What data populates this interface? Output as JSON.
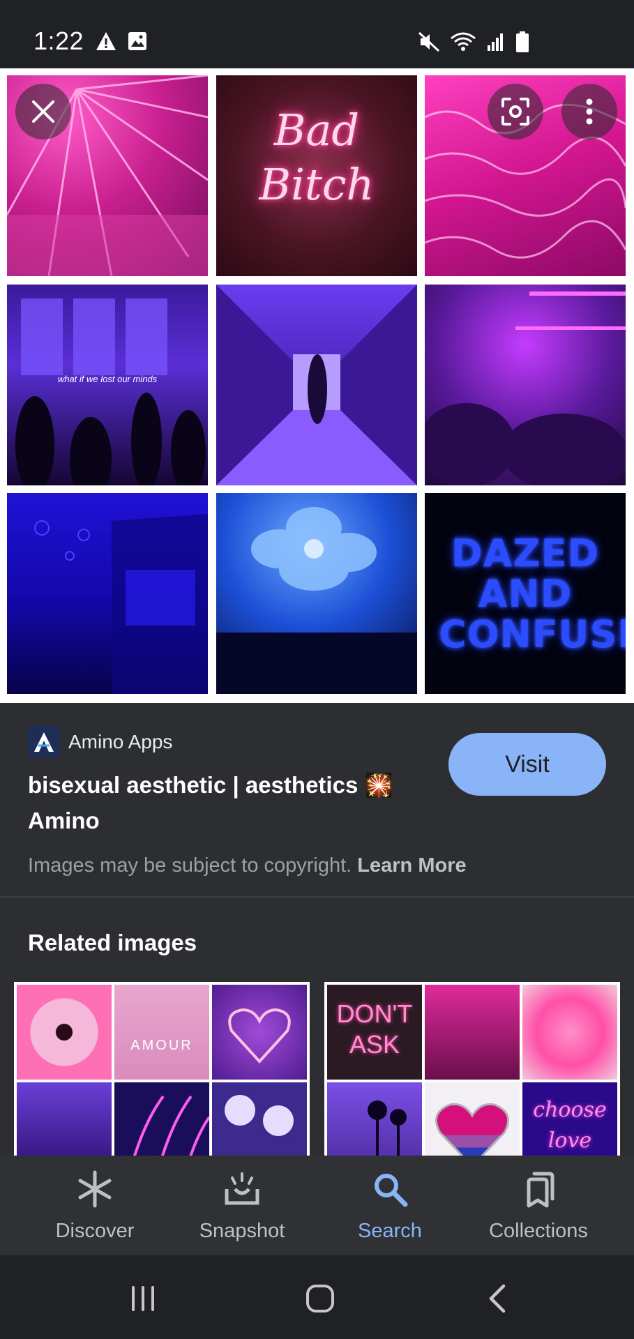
{
  "status_bar": {
    "time": "1:22",
    "left_icons": [
      "warning-icon",
      "image-icon"
    ],
    "right_icons": [
      "mute-icon",
      "wifi-icon",
      "signal-icon",
      "battery-icon"
    ]
  },
  "image_viewer": {
    "tiles": [
      {
        "name": "ferris-wheel-tile",
        "text": ""
      },
      {
        "name": "neon-sign-tile",
        "text": "Bad Bitch"
      },
      {
        "name": "pink-water-tile",
        "text": ""
      },
      {
        "name": "window-silhouettes-tile",
        "text": "what if we lost our minds"
      },
      {
        "name": "purple-hallway-tile",
        "text": ""
      },
      {
        "name": "neon-plants-tile",
        "text": ""
      },
      {
        "name": "blue-room-tile",
        "text": ""
      },
      {
        "name": "blue-flower-tile",
        "text": ""
      },
      {
        "name": "dazed-text-tile",
        "text": "DAZED AND CONFUSED"
      }
    ],
    "close_icon": "close-icon",
    "lens_icon": "lens-icon",
    "more_icon": "more-vert-icon"
  },
  "source": {
    "site_name": "Amino Apps",
    "title": "bisexual aesthetic | aesthetics 🎇 Amino",
    "visit_label": "Visit",
    "copyright_text": "Images may be subject to copyright.",
    "learn_more": "Learn More"
  },
  "related": {
    "heading": "Related images",
    "card1_texts": [
      "AMOUR"
    ],
    "card2_texts": [
      "DON'T ASK",
      "choose love"
    ]
  },
  "bottom_nav": {
    "items": [
      {
        "label": "Discover",
        "icon": "asterisk-icon"
      },
      {
        "label": "Snapshot",
        "icon": "snapshot-icon"
      },
      {
        "label": "Search",
        "icon": "search-icon",
        "active": true
      },
      {
        "label": "Collections",
        "icon": "collections-icon"
      }
    ]
  },
  "colors": {
    "accent": "#8ab4f8",
    "background": "#202124",
    "panel": "#2d2e31"
  }
}
